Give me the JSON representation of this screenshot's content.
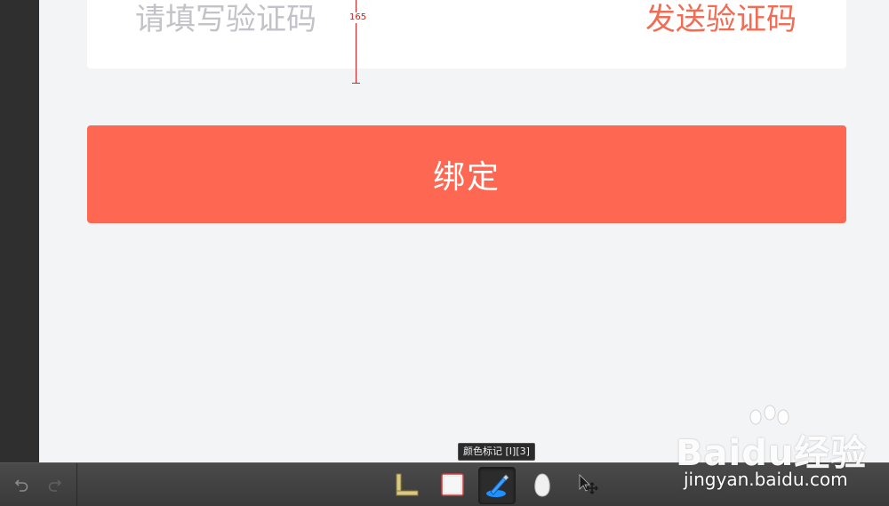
{
  "form": {
    "code_placeholder": "请填写验证码",
    "send_code_label": "发送验证码",
    "bind_label": "绑定"
  },
  "measure": {
    "value_label": "165"
  },
  "tooltip": {
    "text": "颜色标记 [I][3]"
  },
  "toolbar": {
    "tools": [
      {
        "name": "undo-icon"
      },
      {
        "name": "redo-icon"
      },
      {
        "name": "ruler-icon"
      },
      {
        "name": "rectangle-icon"
      },
      {
        "name": "color-marker-icon",
        "active": true
      },
      {
        "name": "slice-icon"
      },
      {
        "name": "move-icon"
      }
    ]
  },
  "watermark": {
    "logo_text": "Baidu经验",
    "url": "jingyan.baidu.com"
  },
  "colors": {
    "accent": "#fe6751",
    "send_text": "#f26b53",
    "placeholder": "#c2c2c8",
    "measure": "#e02020",
    "background": "#f3f4f6"
  }
}
